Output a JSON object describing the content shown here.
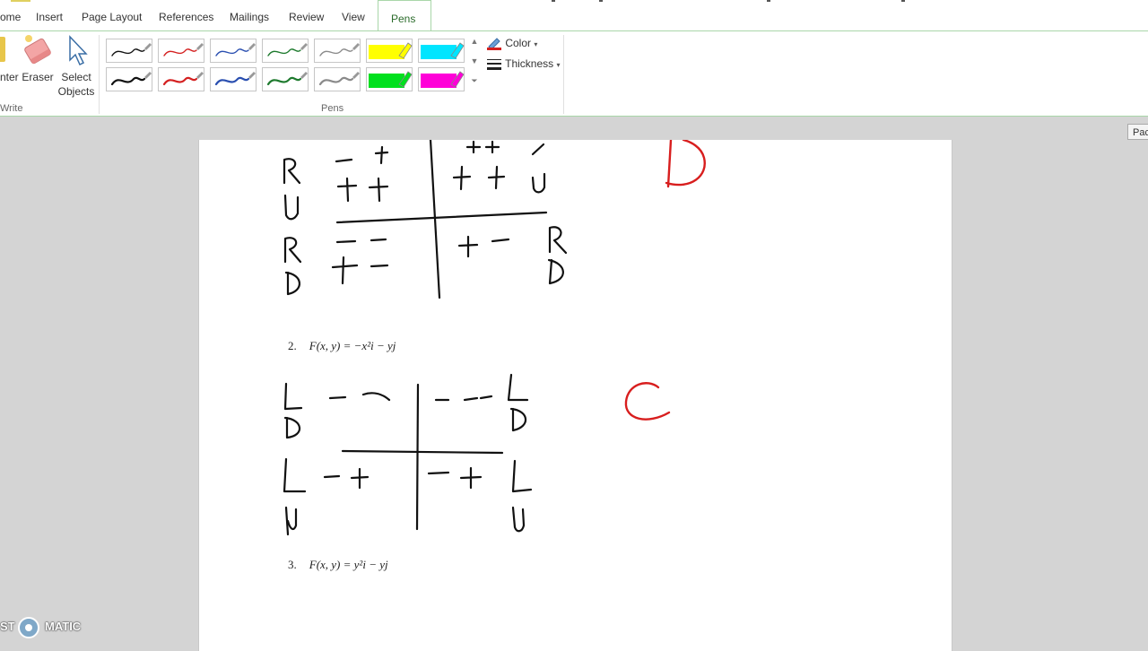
{
  "tabs": [
    {
      "label": "ome"
    },
    {
      "label": "Insert"
    },
    {
      "label": "Page Layout"
    },
    {
      "label": "References"
    },
    {
      "label": "Mailings"
    },
    {
      "label": "Review"
    },
    {
      "label": "View"
    },
    {
      "label": "Pens"
    }
  ],
  "active_tab": "Pens",
  "ribbon": {
    "write_group": {
      "label": "Write",
      "partial_button_label": "nter",
      "eraser_label": "Eraser",
      "select_label_1": "Select",
      "select_label_2": "Objects"
    },
    "pens_group": {
      "label": "Pens",
      "pen_colors": [
        "#111111",
        "#d42020",
        "#2a4fb0",
        "#1e7a2e",
        "#8a8a8a"
      ],
      "highlighter_colors": [
        "#ffff00",
        "#00e5ff",
        "#00e01e",
        "#ff00d8"
      ]
    },
    "color_label": "Color",
    "thickness_label": "Thickness"
  },
  "document": {
    "equation_2": {
      "number": "2.",
      "text": "F(x, y) = −x²i − yj"
    },
    "equation_3": {
      "number": "3.",
      "text": "F(x, y) = y²i − yj"
    },
    "answer_1": "D",
    "answer_2": "C"
  },
  "side_button": "Pac",
  "watermark": {
    "left": "ST",
    "right": "MATIC"
  }
}
